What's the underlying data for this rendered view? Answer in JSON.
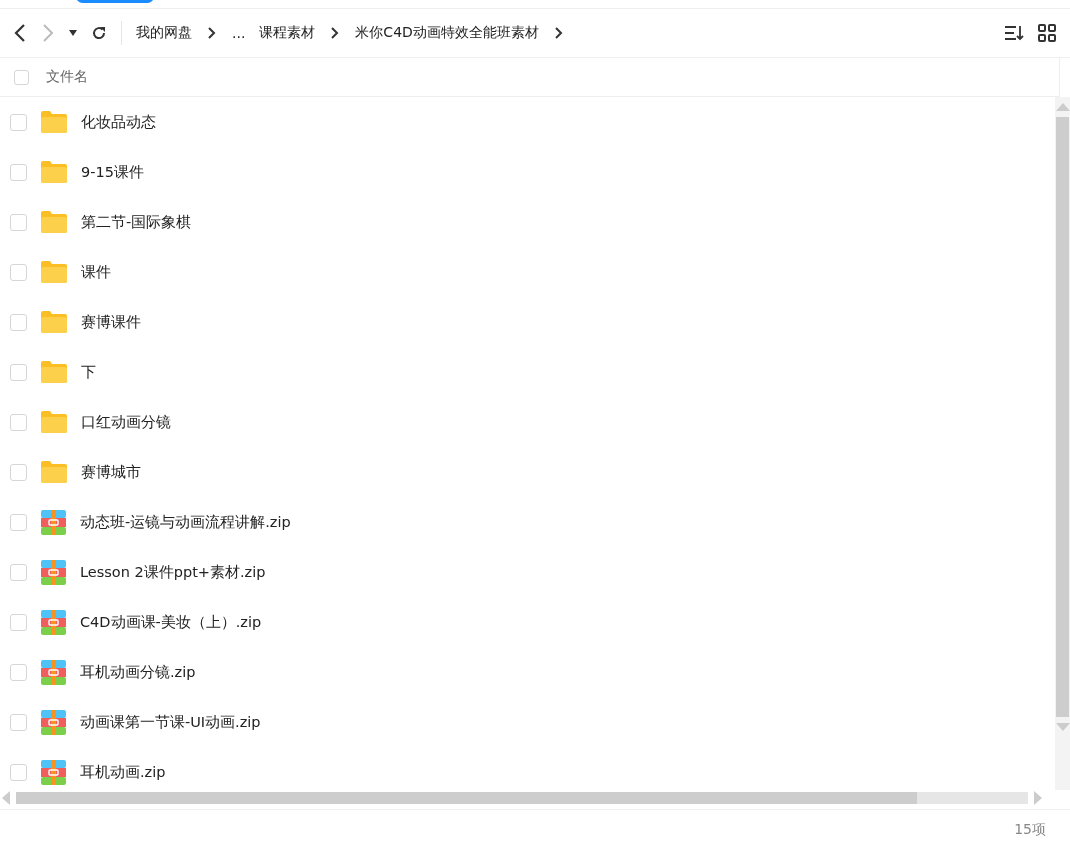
{
  "toolbar": {
    "breadcrumbs": [
      {
        "label": "我的网盘"
      },
      {
        "label": "..."
      },
      {
        "label": "课程素材"
      },
      {
        "label": "米你C4D动画特效全能班素材"
      }
    ]
  },
  "header": {
    "select_all": {
      "checked": false
    },
    "column_1": "文件名"
  },
  "files": [
    {
      "name": "化妆品动态",
      "kind": "folder",
      "checked": false
    },
    {
      "name": "9-15课件",
      "kind": "folder",
      "checked": false
    },
    {
      "name": "第二节-国际象棋",
      "kind": "folder",
      "checked": false
    },
    {
      "name": "课件",
      "kind": "folder",
      "checked": false
    },
    {
      "name": "赛博课件",
      "kind": "folder",
      "checked": false
    },
    {
      "name": "下",
      "kind": "folder",
      "checked": false
    },
    {
      "name": "口红动画分镜",
      "kind": "folder",
      "checked": false
    },
    {
      "name": "赛博城市",
      "kind": "folder",
      "checked": false
    },
    {
      "name": "动态班-运镜与动画流程讲解.zip",
      "kind": "zip",
      "checked": false
    },
    {
      "name": "Lesson 2课件ppt+素材.zip",
      "kind": "zip",
      "checked": false
    },
    {
      "name": "C4D动画课-美妆（上）.zip",
      "kind": "zip",
      "checked": false
    },
    {
      "name": "耳机动画分镜.zip",
      "kind": "zip",
      "checked": false
    },
    {
      "name": "动画课第一节课-UI动画.zip",
      "kind": "zip",
      "checked": false
    },
    {
      "name": "耳机动画.zip",
      "kind": "zip",
      "checked": false
    }
  ],
  "status_bar": {
    "count": "15项"
  }
}
